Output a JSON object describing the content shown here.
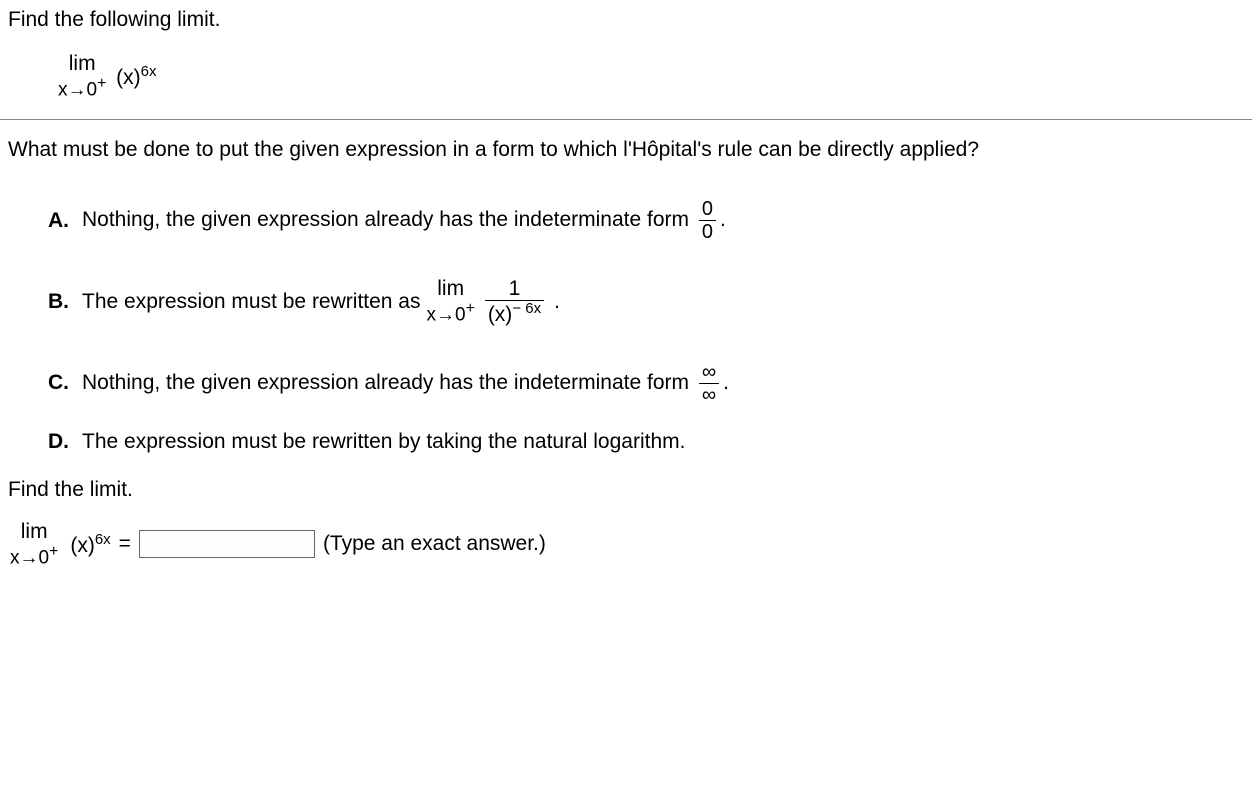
{
  "intro": "Find the following limit.",
  "limit_expr": {
    "lim_label": "lim",
    "approach": "x→0",
    "approach_sup": "+",
    "base": "(x)",
    "exp": "6x"
  },
  "question": "What must be done to put the given expression in a form to which l'Hôpital's rule can be directly applied?",
  "choices": {
    "A": {
      "label": "A.",
      "text_before": "Nothing, the given expression already has the indeterminate form ",
      "frac_num": "0",
      "frac_den": "0",
      "text_after": "."
    },
    "B": {
      "label": "B.",
      "text_before": "The expression must be rewritten as ",
      "lim_label": "lim",
      "approach": "x→0",
      "approach_sup": "+",
      "frac_num": "1",
      "frac_den_base": "(x)",
      "frac_den_exp": "− 6x",
      "text_after": "."
    },
    "C": {
      "label": "C.",
      "text_before": "Nothing, the given expression already has the indeterminate form ",
      "frac_num": "∞",
      "frac_den": "∞",
      "text_after": "."
    },
    "D": {
      "label": "D.",
      "text": "The expression must be rewritten by taking the natural logarithm."
    }
  },
  "find_limit": "Find the limit.",
  "final": {
    "equals": "=",
    "hint": "(Type an exact answer.)"
  }
}
